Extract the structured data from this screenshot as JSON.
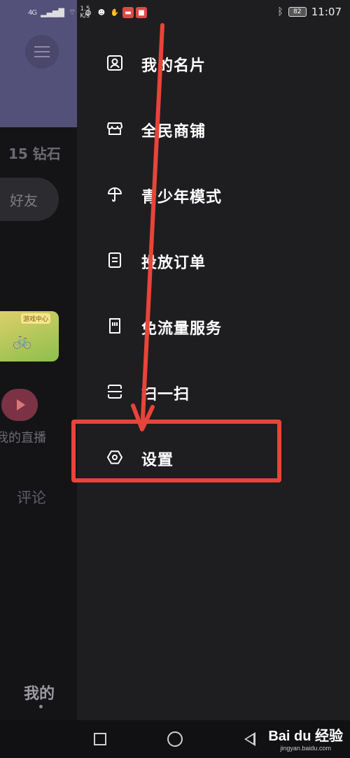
{
  "status_bar": {
    "network": "4G",
    "speed": "1.5 K/s",
    "battery": "82",
    "time": "11:07",
    "apps": [
      {
        "icon": "vpn-icon",
        "color": "#2b2b2b"
      },
      {
        "icon": "qq-icon",
        "color": "#2b2b2b"
      },
      {
        "icon": "hand-icon",
        "color": "#2b2b2b"
      },
      {
        "icon": "app-red-icon",
        "color": "#e04848"
      },
      {
        "icon": "app-red-icon-2",
        "color": "#e04848"
      }
    ]
  },
  "background_page": {
    "diamonds": "15 钻石",
    "friend_button": "好友",
    "game_tag": "游戏中心",
    "live_label": "我的直播",
    "comment": "评论",
    "bottom_tab": "我的"
  },
  "drawer": {
    "items": [
      {
        "label": "我的名片",
        "icon": "profile-card-icon"
      },
      {
        "label": "全民商铺",
        "icon": "shop-icon"
      },
      {
        "label": "青少年模式",
        "icon": "teen-umbrella-icon"
      },
      {
        "label": "投放订单",
        "icon": "order-icon"
      },
      {
        "label": "免流量服务",
        "icon": "sim-card-icon"
      },
      {
        "label": "扫一扫",
        "icon": "scan-icon"
      },
      {
        "label": "设置",
        "icon": "settings-icon"
      }
    ]
  },
  "annotation": {
    "color": "#e8443a"
  },
  "nav_bar": {
    "buttons": [
      "recent-apps",
      "home",
      "back"
    ]
  },
  "watermark": {
    "logo": "Bai du 经验",
    "url": "jingyan.baidu.com"
  }
}
